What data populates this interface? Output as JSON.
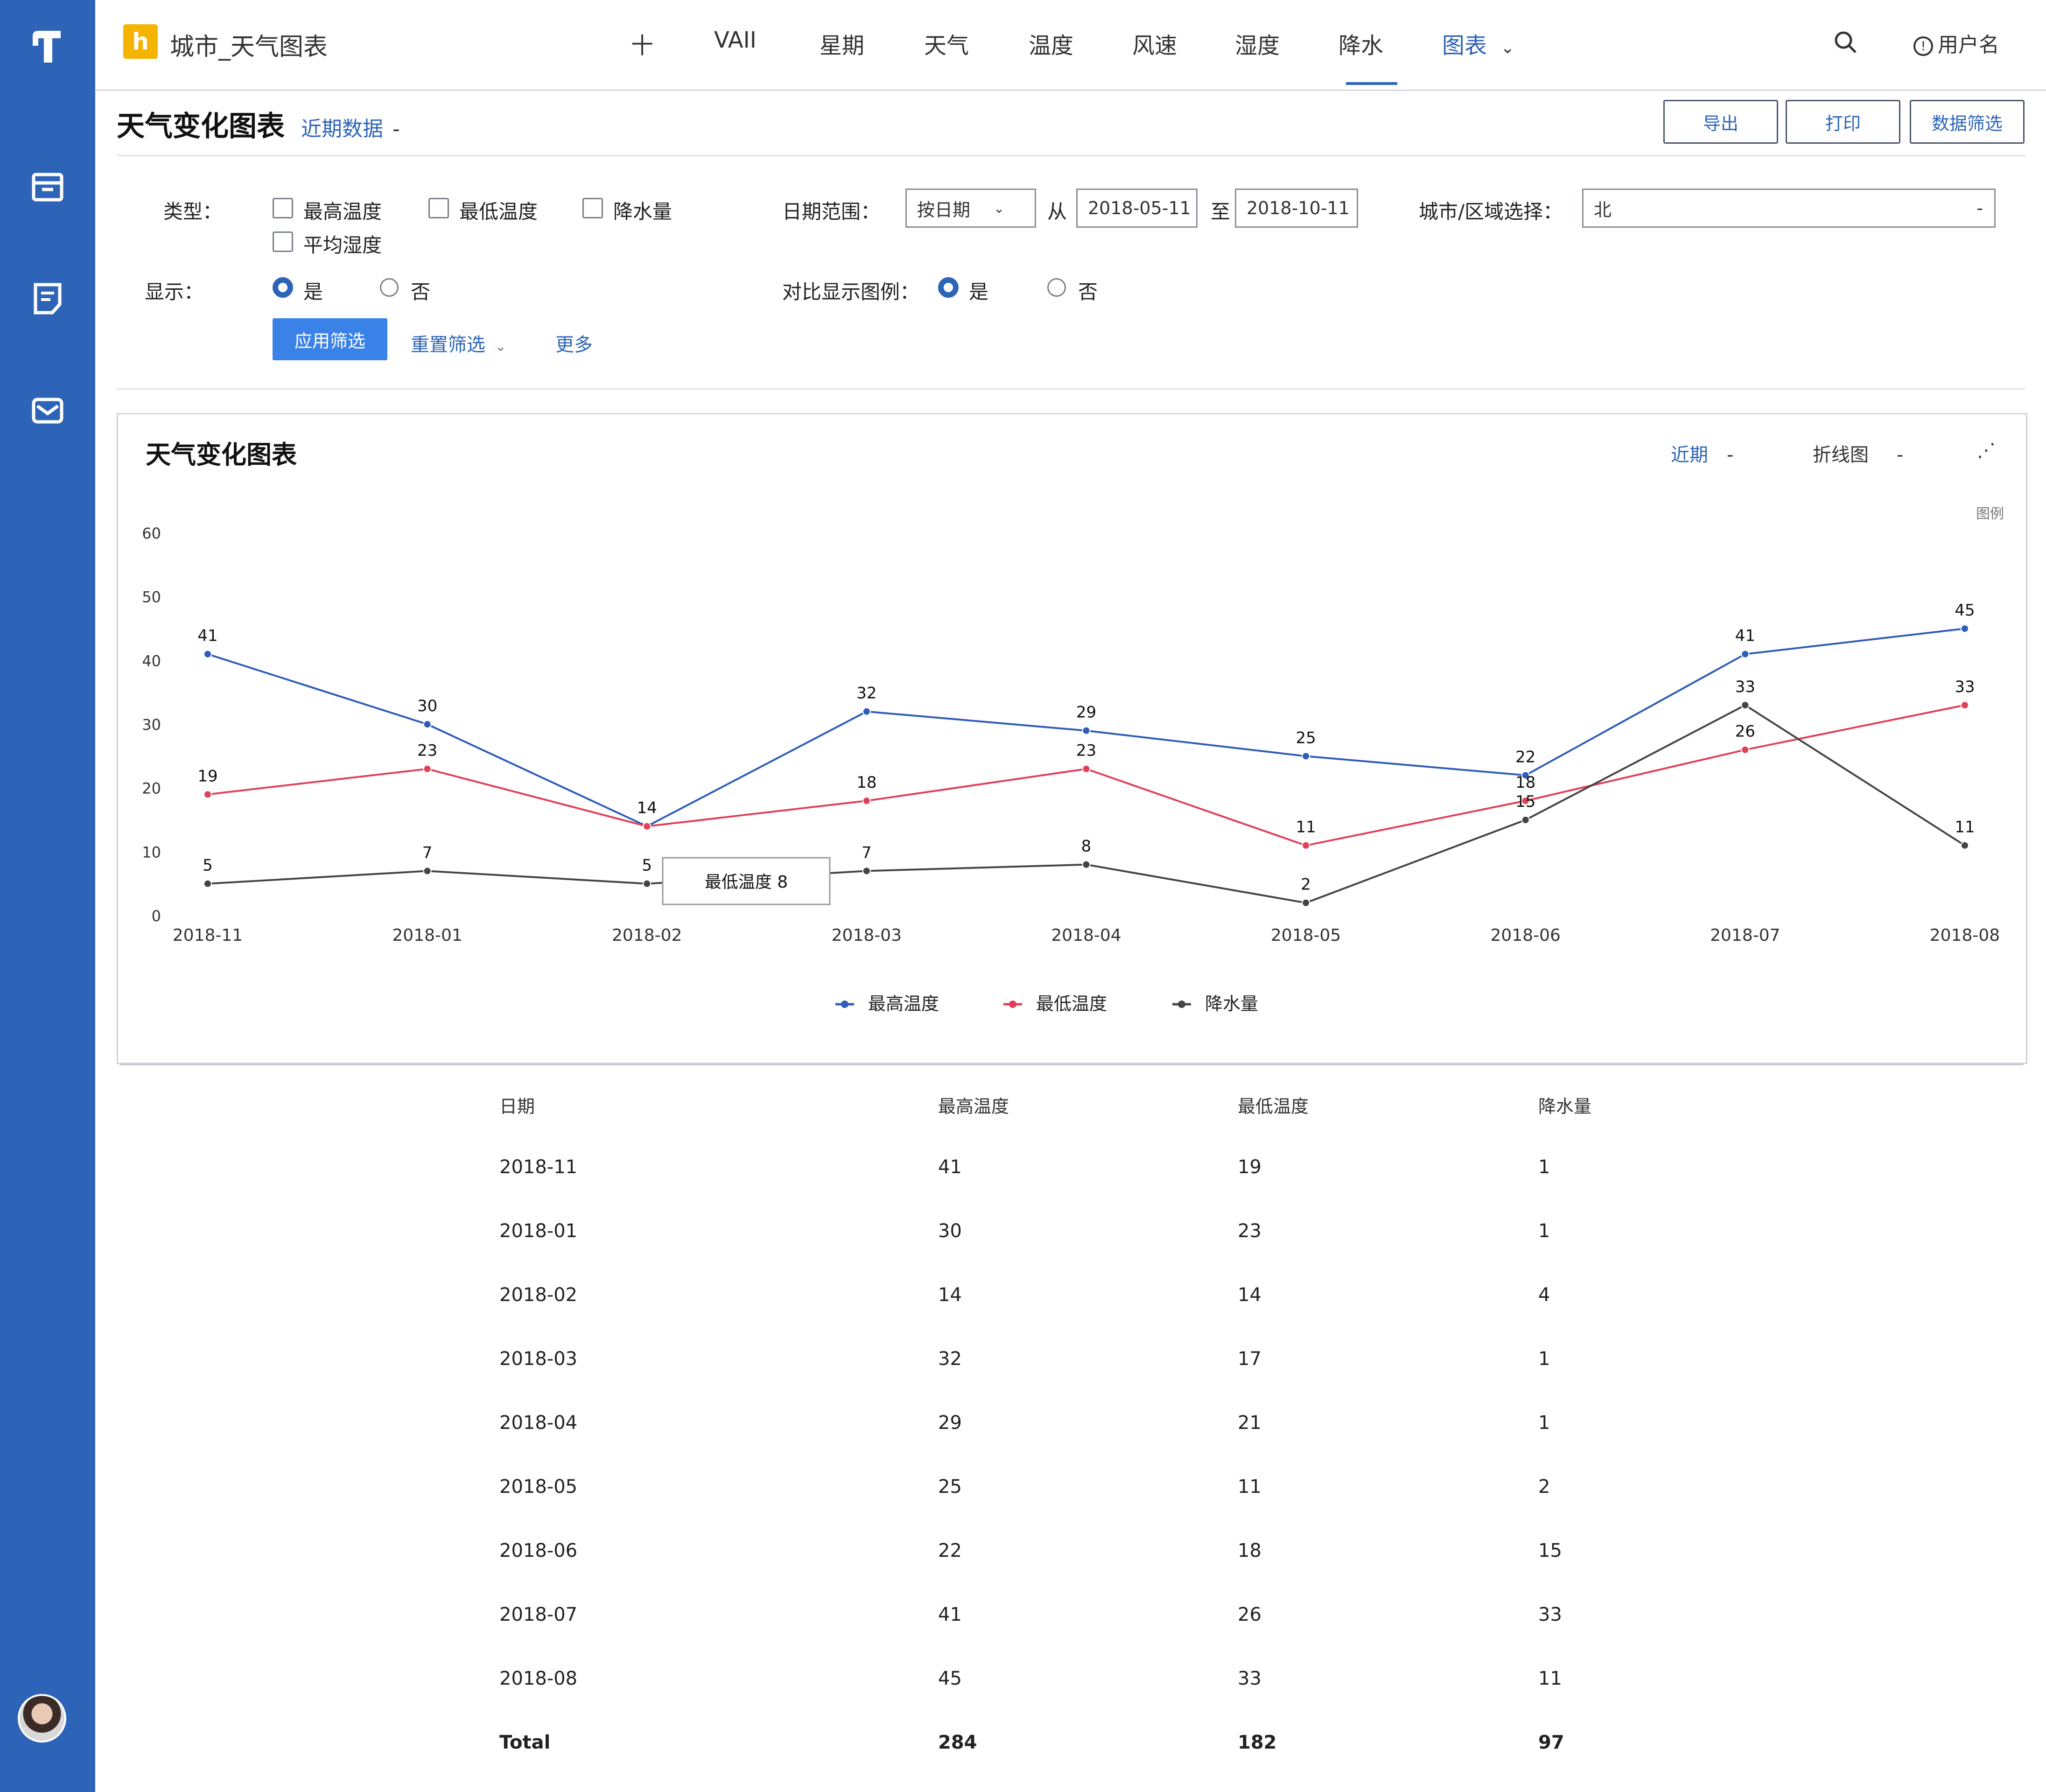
{
  "app": {
    "title": "城市_天气图表"
  },
  "topnav": {
    "items": [
      "十",
      "VAII",
      "星期",
      "天气",
      "温度",
      "风速",
      "湿度",
      "降水",
      "图表"
    ],
    "active_index": 8,
    "user": "用户名"
  },
  "page": {
    "title": "天气变化图表",
    "subtitle": "近期数据",
    "buttons": [
      "导出",
      "打印",
      "数据筛选"
    ]
  },
  "filters": {
    "type_label": "类型：",
    "type_options": [
      "最高温度",
      "最低温度",
      "降水量",
      "平均湿度"
    ],
    "date_label": "日期范围：",
    "date_select": "按日期",
    "date_from": "2018-05-11",
    "date_sep": "至",
    "date_to": "2018-10-11",
    "city_label": "城市/区域选择：",
    "city_value": "北",
    "show_label": "显示：",
    "show_yes": "是",
    "show_no": "否",
    "compare_label": "对比显示图例：",
    "compare_yes": "是",
    "compare_no": "否",
    "apply": "应用筛选",
    "reset": "重置筛选",
    "more": "更多"
  },
  "chart_panel": {
    "title": "天气变化图表",
    "ctrl_range": "近期",
    "ctrl_type": "折线图",
    "corner": "图例",
    "tooltip": "最低温度 8"
  },
  "chart_data": {
    "type": "line",
    "x": [
      "2018-11",
      "2018-01",
      "2018-02",
      "2018-03",
      "2018-04",
      "2018-05",
      "2018-06",
      "2018-07",
      "2018-08"
    ],
    "ylim": [
      0,
      60
    ],
    "yticks": [
      0,
      10,
      20,
      30,
      40,
      50,
      60
    ],
    "series": [
      {
        "name": "最高温度",
        "color": "#2e5cb8",
        "values": [
          41,
          30,
          14,
          32,
          29,
          25,
          22,
          41,
          45
        ]
      },
      {
        "name": "最低温度",
        "color": "#e0405a",
        "values": [
          19,
          23,
          14,
          18,
          23,
          11,
          18,
          26,
          33
        ]
      },
      {
        "name": "降水量",
        "color": "#444444",
        "values": [
          5,
          7,
          5,
          7,
          8,
          2,
          15,
          33,
          11
        ]
      }
    ]
  },
  "table": {
    "headers": [
      "日期",
      "最高温度",
      "最低温度",
      "降水量"
    ],
    "rows": [
      [
        "2018-11",
        "41",
        "19",
        "1"
      ],
      [
        "2018-01",
        "30",
        "23",
        "1"
      ],
      [
        "2018-02",
        "14",
        "14",
        "4"
      ],
      [
        "2018-03",
        "32",
        "17",
        "1"
      ],
      [
        "2018-04",
        "29",
        "21",
        "1"
      ],
      [
        "2018-05",
        "25",
        "11",
        "2"
      ],
      [
        "2018-06",
        "22",
        "18",
        "15"
      ],
      [
        "2018-07",
        "41",
        "26",
        "33"
      ],
      [
        "2018-08",
        "45",
        "33",
        "11"
      ]
    ],
    "total": [
      "Total",
      "284",
      "182",
      "97"
    ]
  }
}
